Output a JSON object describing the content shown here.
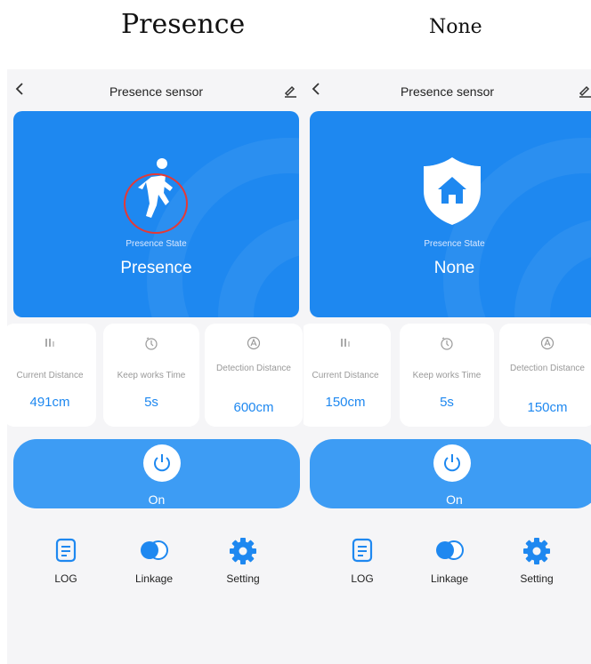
{
  "captions": {
    "left": "Presence",
    "right": "None"
  },
  "panels": [
    {
      "header_title": "Presence sensor",
      "state_label": "Presence State",
      "state_value": "Presence",
      "cards": [
        {
          "label": "Current Distance",
          "value": "491cm",
          "icon": "signal-bars-icon"
        },
        {
          "label": "Keep works Time",
          "value": "5s",
          "icon": "timer-icon"
        },
        {
          "label": "Detection Distance",
          "value": "600cm",
          "icon": "radar-icon"
        }
      ],
      "power_label": "On",
      "nav": [
        {
          "label": "LOG",
          "icon": "log-document-icon"
        },
        {
          "label": "Linkage",
          "icon": "toggle-link-icon"
        },
        {
          "label": "Setting",
          "icon": "gear-icon"
        }
      ]
    },
    {
      "header_title": "Presence sensor",
      "state_label": "Presence State",
      "state_value": "None",
      "cards": [
        {
          "label": "Current Distance",
          "value": "150cm",
          "icon": "signal-bars-icon"
        },
        {
          "label": "Keep works Time",
          "value": "5s",
          "icon": "timer-icon"
        },
        {
          "label": "Detection Distance",
          "value": "150cm",
          "icon": "radar-icon"
        }
      ],
      "power_label": "On",
      "nav": [
        {
          "label": "LOG",
          "icon": "log-document-icon"
        },
        {
          "label": "Linkage",
          "icon": "toggle-link-icon"
        },
        {
          "label": "Setting",
          "icon": "gear-icon"
        }
      ]
    }
  ],
  "colors": {
    "primary": "#1e88f0",
    "power_bar": "#3d9cf4",
    "highlight_ring": "#e53935",
    "background": "#f5f5f7"
  }
}
